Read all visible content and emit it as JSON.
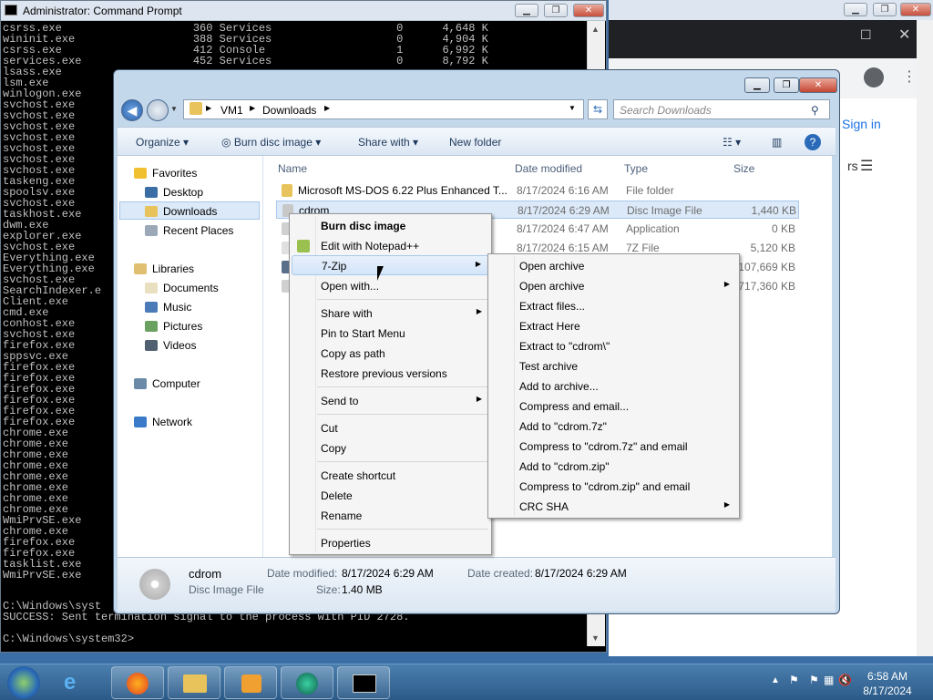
{
  "cmd": {
    "title": "Administrator: Command Prompt",
    "lines": "csrss.exe                    360 Services                   0      4,648 K\nwininit.exe                  388 Services                   0      4,904 K\ncsrss.exe                    412 Console                    1      6,992 K\nservices.exe                 452 Services                   0      8,792 K\nlsass.exe\nlsm.exe\nwinlogon.exe\nsvchost.exe\nsvchost.exe\nsvchost.exe\nsvchost.exe\nsvchost.exe\nsvchost.exe\nsvchost.exe\ntaskeng.exe\nspoolsv.exe\nsvchost.exe\ntaskhost.exe\ndwm.exe\nexplorer.exe\nsvchost.exe\nEverything.exe\nEverything.exe\nsvchost.exe\nSearchIndexer.e\nClient.exe\ncmd.exe\nconhost.exe\nsvchost.exe\nfirefox.exe\nsppsvc.exe\nfirefox.exe\nfirefox.exe\nfirefox.exe\nfirefox.exe\nfirefox.exe\nfirefox.exe\nchrome.exe\nchrome.exe\nchrome.exe\nchrome.exe\nchrome.exe\nchrome.exe\nchrome.exe\nchrome.exe\nWmiPrvSE.exe\nchrome.exe\nfirefox.exe\nfirefox.exe\ntasklist.exe\nWmiPrvSE.exe",
    "bottom": "C:\\Windows\\syst\nSUCCESS: Sent termination signal to the process with PID 2728.\n\nC:\\Windows\\system32>"
  },
  "chrome": {
    "sign_in": "Sign in",
    "partial_text": "rs"
  },
  "explorer": {
    "breadcrumb": [
      "VM1",
      "Downloads"
    ],
    "search_placeholder": "Search Downloads",
    "toolbar": {
      "organize": "Organize",
      "burn": "Burn disc image",
      "share": "Share with",
      "new_folder": "New folder"
    },
    "nav": {
      "favorites": "Favorites",
      "desktop": "Desktop",
      "downloads": "Downloads",
      "recent": "Recent Places",
      "libraries": "Libraries",
      "documents": "Documents",
      "music": "Music",
      "pictures": "Pictures",
      "videos": "Videos",
      "computer": "Computer",
      "network": "Network"
    },
    "columns": {
      "name": "Name",
      "date": "Date modified",
      "type": "Type",
      "size": "Size"
    },
    "files": [
      {
        "name": "Microsoft MS-DOS 6.22 Plus Enhanced T...",
        "date": "8/17/2024 6:16 AM",
        "type": "File folder",
        "size": "",
        "color": "#e8c25a"
      },
      {
        "name": "cdrom",
        "date": "8/17/2024 6:29 AM",
        "type": "Disc Image File",
        "size": "1,440 KB",
        "color": "#c8c8c8"
      },
      {
        "name": "",
        "date": "8/17/2024 6:47 AM",
        "type": "Application",
        "size": "0 KB",
        "color": "#d0d0d0"
      },
      {
        "name": "",
        "date": "8/17/2024 6:15 AM",
        "type": "7Z File",
        "size": "5,120 KB",
        "color": "#e0e0e0"
      },
      {
        "name": "",
        "date": "",
        "type": "",
        "size": "107,669 KB",
        "color": "#5a6f8a"
      },
      {
        "name": "",
        "date": "",
        "type": "",
        "size": "717,360 KB",
        "color": "#d0d0d0"
      }
    ],
    "details": {
      "name": "cdrom",
      "type": "Disc Image File",
      "modified_label": "Date modified:",
      "modified": "8/17/2024 6:29 AM",
      "created_label": "Date created:",
      "created": "8/17/2024 6:29 AM",
      "size_label": "Size:",
      "size": "1.40 MB"
    }
  },
  "context_menu": {
    "burn": "Burn disc image",
    "notepad": "Edit with Notepad++",
    "zip": "7-Zip",
    "open_with": "Open with...",
    "share": "Share with",
    "pin": "Pin to Start Menu",
    "copy_path": "Copy as path",
    "restore": "Restore previous versions",
    "send_to": "Send to",
    "cut": "Cut",
    "copy": "Copy",
    "shortcut": "Create shortcut",
    "delete": "Delete",
    "rename": "Rename",
    "properties": "Properties"
  },
  "zip_menu": [
    "Open archive",
    "Open archive",
    "Extract files...",
    "Extract Here",
    "Extract to \"cdrom\\\"",
    "Test archive",
    "Add to archive...",
    "Compress and email...",
    "Add to \"cdrom.7z\"",
    "Compress to \"cdrom.7z\" and email",
    "Add to \"cdrom.zip\"",
    "Compress to \"cdrom.zip\" and email",
    "CRC SHA"
  ],
  "taskbar": {
    "time": "6:58 AM",
    "date": "8/17/2024"
  }
}
